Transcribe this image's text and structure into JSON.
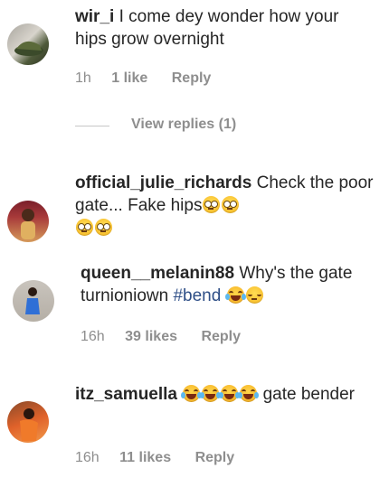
{
  "comments": [
    {
      "username": "wir_i",
      "text": "I come dey wonder how your hips grow overnight",
      "time": "1h",
      "likes": "1 like",
      "reply": "Reply",
      "avatar_icon": "user-avatar-shoes"
    },
    {
      "username": "official_julie_richards",
      "text_part1": "Check the poor gate... Fake hips",
      "emojis": [
        "eye-roll-emoji",
        "eye-roll-emoji",
        "eye-roll-emoji",
        "eye-roll-emoji"
      ],
      "avatar_icon": "user-avatar-woman"
    },
    {
      "username": "queen__melanin88",
      "text_part1": "Why's the gate turnioniown",
      "hashtag": "#bend",
      "emojis": [
        "laughing-tears-emoji",
        "pensive-emoji"
      ],
      "time": "16h",
      "likes": "39 likes",
      "reply": "Reply",
      "avatar_icon": "user-avatar-blue-dress"
    },
    {
      "username": "itz_samuella",
      "text_part1": "gate bender",
      "emojis": [
        "laughing-tears-emoji",
        "laughing-tears-emoji",
        "laughing-tears-emoji",
        "laughing-tears-emoji"
      ],
      "time": "16h",
      "likes": "11 likes",
      "reply": "Reply",
      "avatar_icon": "user-avatar-orange"
    }
  ],
  "view_replies": "View replies (1)",
  "colors": {
    "text": "#262626",
    "meta": "#8e8e8e",
    "hashtag": "#2f4f87"
  }
}
